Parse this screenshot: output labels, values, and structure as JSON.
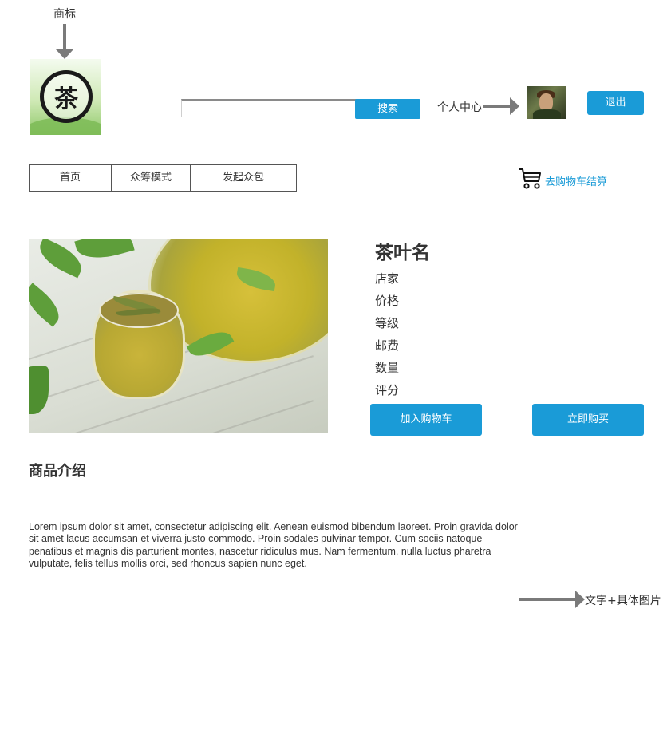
{
  "annotations": {
    "logo_label": "商标",
    "bottom_note": "文字+具体图片"
  },
  "logo": {
    "glyph": "茶"
  },
  "header": {
    "search_placeholder": "",
    "search_button": "搜索",
    "user_center": "个人中心",
    "logout": "退出"
  },
  "nav": {
    "items": [
      {
        "label": "首页"
      },
      {
        "label": "众筹模式"
      },
      {
        "label": "发起众包"
      }
    ],
    "cart_link": "去购物车结算"
  },
  "product": {
    "name": "茶叶名",
    "attributes": [
      "店家",
      "价格",
      "等级",
      "邮费",
      "数量",
      "评分"
    ],
    "add_to_cart": "加入购物车",
    "buy_now": "立即购买"
  },
  "description": {
    "title": "商品介绍",
    "text": "Lorem ipsum dolor sit amet, consectetur adipiscing elit. Aenean euismod bibendum laoreet. Proin gravida dolor sit amet lacus accumsan et viverra justo commodo. Proin sodales pulvinar tempor. Cum sociis natoque penatibus et magnis dis parturient montes, nascetur ridiculus mus. Nam fermentum, nulla luctus pharetra vulputate, felis tellus mollis orci, sed rhoncus sapien nunc eget."
  },
  "colors": {
    "accent": "#1a9bd7",
    "annotation_arrow": "#7a7a7a"
  },
  "icons": {
    "cart": "shopping-cart-icon",
    "arrow": "arrow-icon"
  }
}
